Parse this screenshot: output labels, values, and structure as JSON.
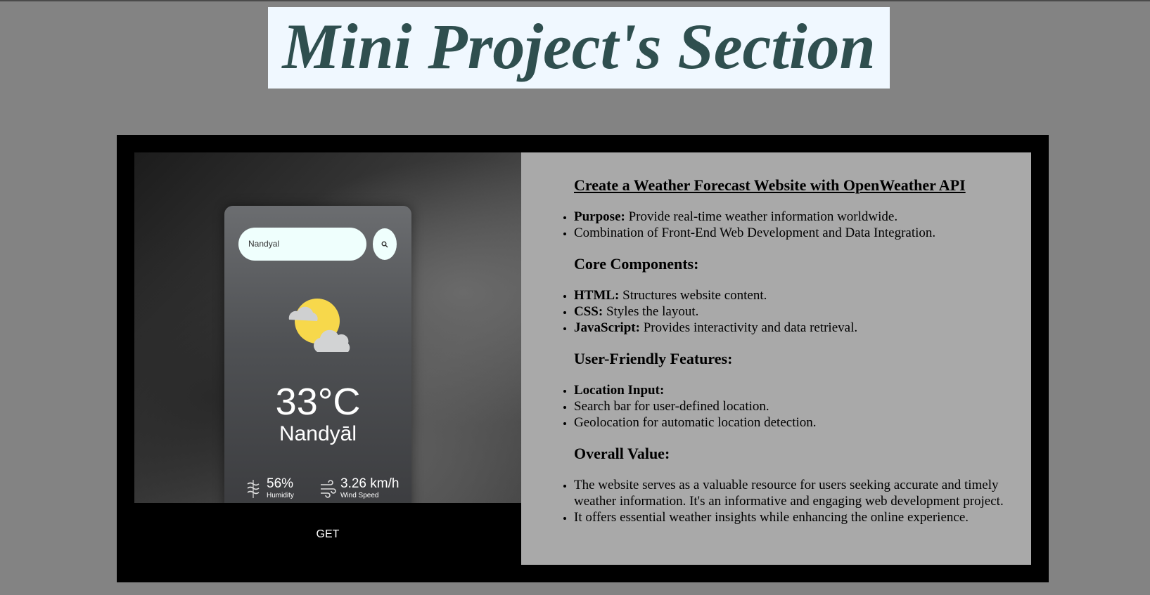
{
  "header": {
    "title": "Mini Project's Section"
  },
  "project": {
    "preview": {
      "search_placeholder": "Nandyal",
      "temperature": "33°C",
      "city": "Nandyāl",
      "humidity_value": "56%",
      "humidity_label": "Humidity",
      "wind_value": "3.26 km/h",
      "wind_label": "Wind Speed"
    },
    "get_button": "GET",
    "info": {
      "title": "Create a Weather Forecast Website with OpenWeather API",
      "intro": [
        {
          "bold": "Purpose:",
          "text": " Provide real-time weather information worldwide."
        },
        {
          "bold": "",
          "text": "Combination of Front-End Web Development and Data Integration."
        }
      ],
      "core_heading": "Core Components:",
      "core": [
        {
          "bold": "HTML:",
          "text": " Structures website content."
        },
        {
          "bold": "CSS:",
          "text": " Styles the layout."
        },
        {
          "bold": "JavaScript:",
          "text": " Provides interactivity and data retrieval."
        }
      ],
      "features_heading": "User-Friendly Features:",
      "features": [
        {
          "bold": "Location Input:",
          "text": ""
        },
        {
          "bold": "",
          "text": "Search bar for user-defined location."
        },
        {
          "bold": "",
          "text": "Geolocation for automatic location detection."
        }
      ],
      "value_heading": "Overall Value:",
      "value": [
        {
          "bold": "",
          "text": "The website serves as a valuable resource for users seeking accurate and timely weather information. It's an informative and engaging web development project."
        },
        {
          "bold": "",
          "text": "It offers essential weather insights while enhancing the online experience."
        }
      ]
    }
  },
  "colors": {
    "page_bg": "#838383",
    "title_bg": "#f0f8ff",
    "title_text": "#2f4f4f",
    "card_bg": "#000000",
    "info_bg": "#a9a9a9",
    "sun": "#f7d84b"
  },
  "icons": [
    "search-icon",
    "partly-cloudy-icon",
    "humidity-icon",
    "wind-icon"
  ]
}
